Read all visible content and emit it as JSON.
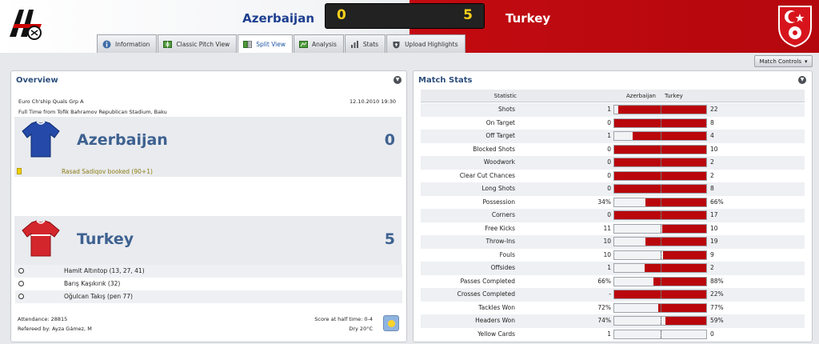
{
  "header": {
    "home_team": "Azerbaijan",
    "away_team": "Turkey",
    "home_score": "0",
    "away_score": "5"
  },
  "colors": {
    "home_accent": "#1d3f8f",
    "away_accent": "#c20b11",
    "score": "#ffd11a",
    "bar": "#b9070c"
  },
  "tabs": [
    {
      "label": "Information",
      "icon": "info-icon"
    },
    {
      "label": "Classic Pitch View",
      "icon": "pitch-icon"
    },
    {
      "label": "Split View",
      "icon": "split-view-icon",
      "active": true
    },
    {
      "label": "Analysis",
      "icon": "analysis-icon"
    },
    {
      "label": "Stats",
      "icon": "stats-icon"
    },
    {
      "label": "Upload Highlights",
      "icon": "upload-icon"
    }
  ],
  "match_controls_label": "Match Controls",
  "overview": {
    "title": "Overview",
    "competition": "Euro Ch'ship Quals Grp A",
    "kickoff": "12.10.2010 19:30",
    "venue": "Full Time from Tofik Bahramov Republican Stadium, Baku",
    "home": {
      "name": "Azerbaijan",
      "score": "0",
      "event": "Rasad Sadiqov booked (90+1)"
    },
    "away": {
      "name": "Turkey",
      "score": "5"
    },
    "goals": [
      "Hamit Altıntop (13, 27, 41)",
      "Barış Kaşıkırık (32)",
      "Oğulcan Takış (pen 77)"
    ],
    "attendance": "Attendance: 28815",
    "referee": "Refereed by: Ayza Gámez, M",
    "halftime": "Score at half time: 0-4",
    "weather": "Dry 20°C",
    "weather_icon": "sunny-icon"
  },
  "match_stats": {
    "title": "Match Stats",
    "col_statistic": "Statistic",
    "col_home": "Azerbaijan",
    "col_away": "Turkey",
    "rows": [
      {
        "label": "Shots",
        "home": "1",
        "away": "22",
        "home_share": 0.04
      },
      {
        "label": "On Target",
        "home": "0",
        "away": "8",
        "home_share": 0
      },
      {
        "label": "Off Target",
        "home": "1",
        "away": "4",
        "home_share": 0.2
      },
      {
        "label": "Blocked Shots",
        "home": "0",
        "away": "10",
        "home_share": 0
      },
      {
        "label": "Woodwork",
        "home": "0",
        "away": "2",
        "home_share": 0
      },
      {
        "label": "Clear Cut Chances",
        "home": "0",
        "away": "2",
        "home_share": 0
      },
      {
        "label": "Long Shots",
        "home": "0",
        "away": "8",
        "home_share": 0
      },
      {
        "label": "Possession",
        "home": "34%",
        "away": "66%",
        "home_share": 0.34
      },
      {
        "label": "Corners",
        "home": "0",
        "away": "17",
        "home_share": 0
      },
      {
        "label": "Free Kicks",
        "home": "11",
        "away": "10",
        "home_share": 0.52
      },
      {
        "label": "Throw-Ins",
        "home": "10",
        "away": "19",
        "home_share": 0.34
      },
      {
        "label": "Fouls",
        "home": "10",
        "away": "9",
        "home_share": 0.53
      },
      {
        "label": "Offsides",
        "home": "1",
        "away": "2",
        "home_share": 0.33
      },
      {
        "label": "Passes Completed",
        "home": "66%",
        "away": "88%",
        "home_share": 0.43
      },
      {
        "label": "Crosses Completed",
        "home": "-",
        "away": "22%",
        "home_share": 0
      },
      {
        "label": "Tackles Won",
        "home": "72%",
        "away": "77%",
        "home_share": 0.48
      },
      {
        "label": "Headers Won",
        "home": "74%",
        "away": "59%",
        "home_share": 0.56
      },
      {
        "label": "Yellow Cards",
        "home": "1",
        "away": "0",
        "home_share": 1
      }
    ]
  }
}
